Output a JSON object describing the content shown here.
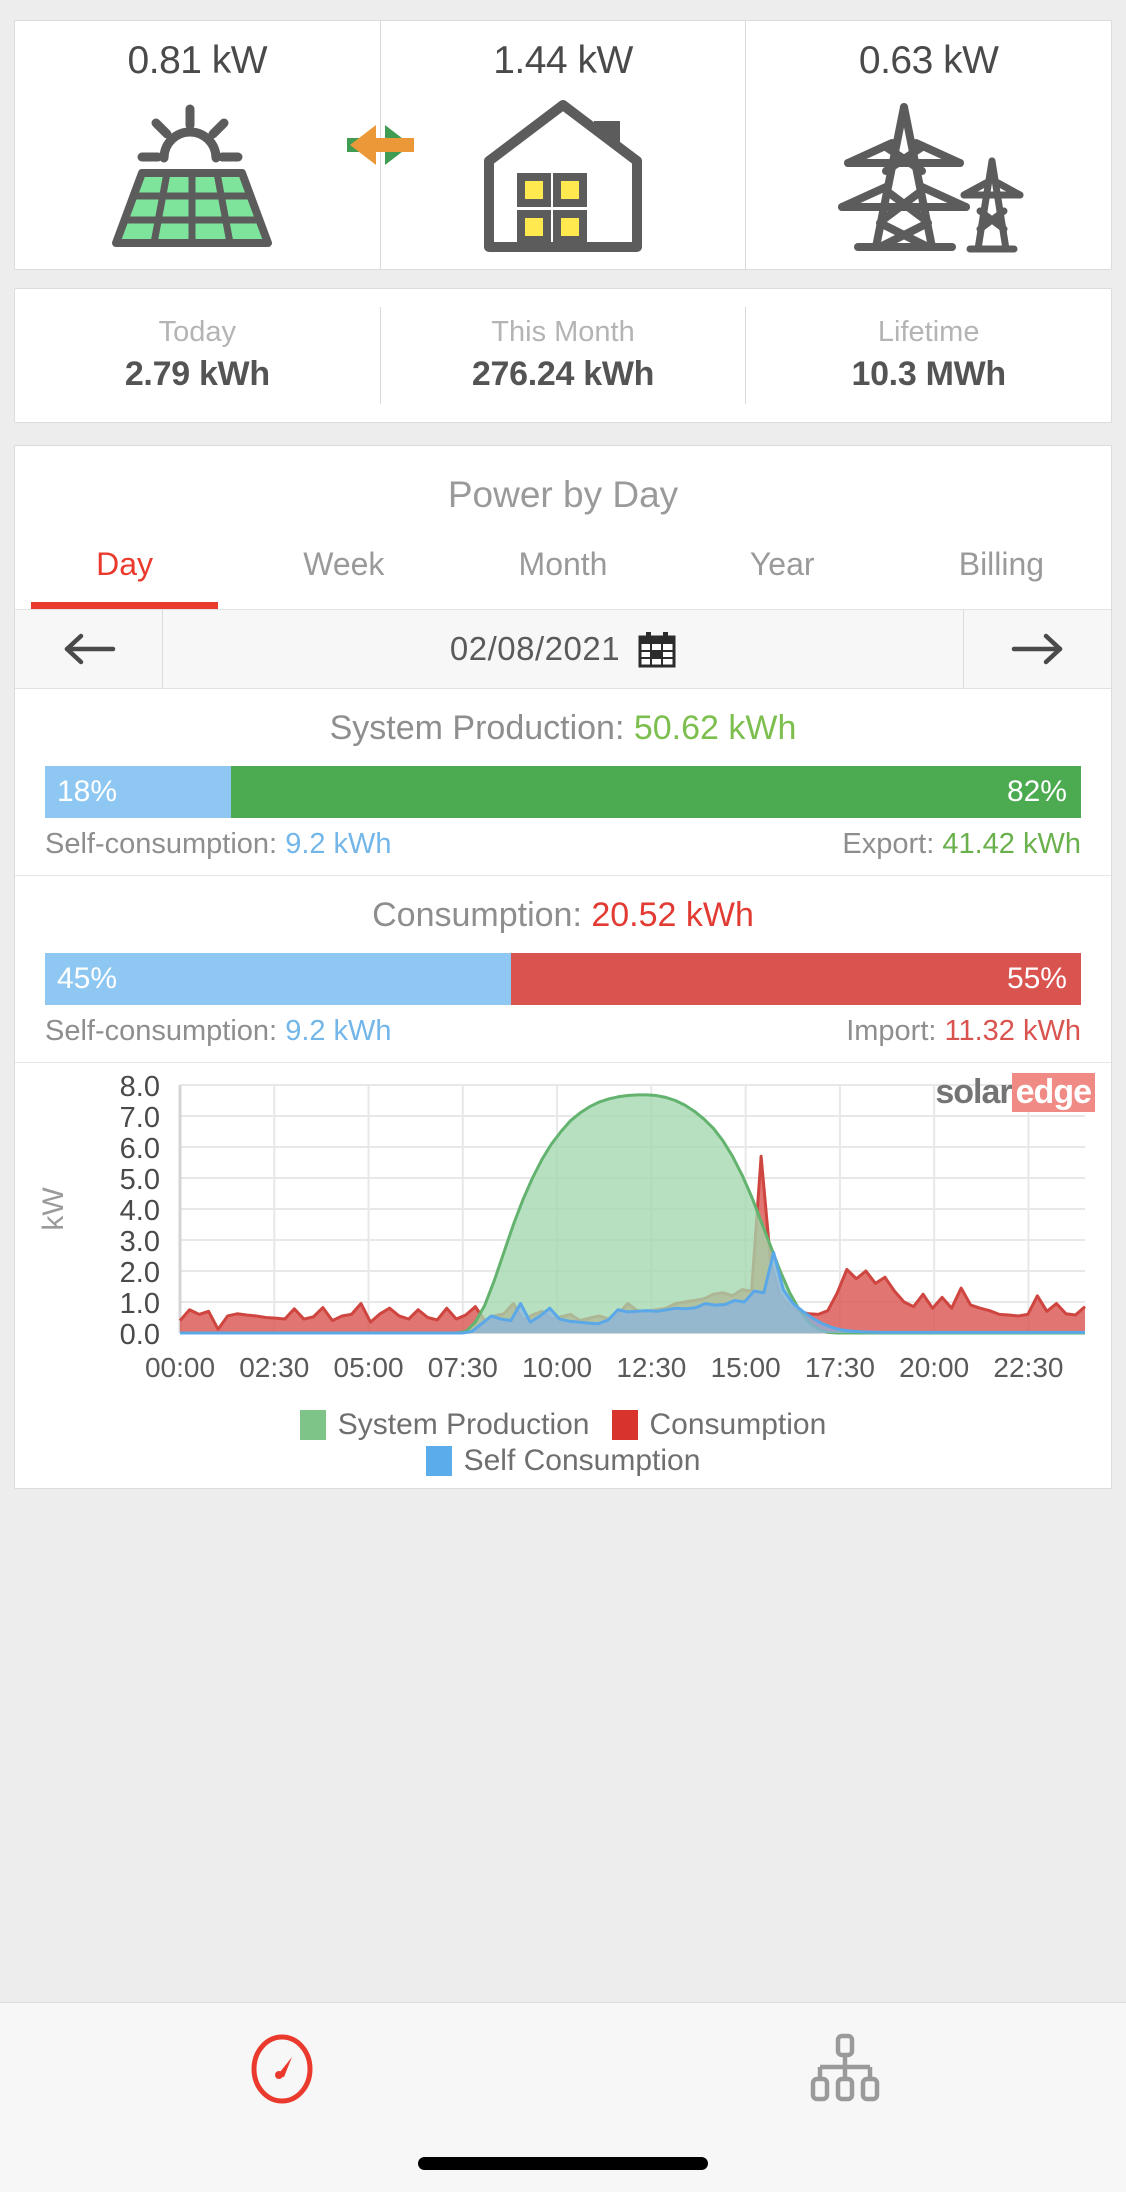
{
  "flow": {
    "cells": [
      {
        "value": "0.81 kW",
        "icon": "solar-panel-icon",
        "name": "production"
      },
      {
        "value": "1.44 kW",
        "icon": "house-icon",
        "name": "consumption"
      },
      {
        "value": "0.63 kW",
        "icon": "grid-tower-icon",
        "name": "grid"
      }
    ],
    "arrow_production_to_house": {
      "icon": "arrow-right-icon",
      "color": "#3f9c52"
    },
    "arrow_grid_to_house": {
      "icon": "arrow-left-icon",
      "color": "#eb9838"
    }
  },
  "stats": [
    {
      "label": "Today",
      "value": "2.79 kWh"
    },
    {
      "label": "This Month",
      "value": "276.24 kWh"
    },
    {
      "label": "Lifetime",
      "value": "10.3 MWh"
    }
  ],
  "power": {
    "title": "Power by Day",
    "tabs": [
      {
        "label": "Day",
        "active": true
      },
      {
        "label": "Week",
        "active": false
      },
      {
        "label": "Month",
        "active": false
      },
      {
        "label": "Year",
        "active": false
      },
      {
        "label": "Billing",
        "active": false
      }
    ],
    "date": {
      "prev_icon": "arrow-left-icon",
      "next_icon": "arrow-right-icon",
      "value": "02/08/2021",
      "calendar_icon": "calendar-icon"
    },
    "production": {
      "head_label": "System Production:",
      "head_value": "50.62 kWh",
      "left_pct": "18%",
      "right_pct": "82%",
      "left_pct_num": 18,
      "right_pct_num": 82,
      "foot_left_label": "Self-consumption:",
      "foot_left_value": "9.2 kWh",
      "foot_right_label": "Export:",
      "foot_right_value": "41.42 kWh"
    },
    "consumption": {
      "head_label": "Consumption:",
      "head_value": "20.52 kWh",
      "left_pct": "45%",
      "right_pct": "55%",
      "left_pct_num": 45,
      "right_pct_num": 55,
      "foot_left_label": "Self-consumption:",
      "foot_left_value": "9.2 kWh",
      "foot_right_label": "Import:",
      "foot_right_value": "11.32 kWh"
    },
    "brand": {
      "part1": "solar",
      "part2": "edge"
    }
  },
  "chart_data": {
    "type": "area",
    "title": "Power by Day",
    "xlabel": "",
    "ylabel": "kW",
    "ylim": [
      0,
      8
    ],
    "yticks": [
      "0.0",
      "1.0",
      "2.0",
      "3.0",
      "4.0",
      "5.0",
      "6.0",
      "7.0",
      "8.0"
    ],
    "xticks": [
      "00:00",
      "02:30",
      "05:00",
      "07:30",
      "10:00",
      "12:30",
      "15:00",
      "17:30",
      "20:00",
      "22:30"
    ],
    "grid": true,
    "legend_position": "bottom",
    "x_hours_range": [
      0,
      24
    ],
    "series": [
      {
        "name": "System Production",
        "color": "#a3d7ae",
        "line_color": "#63b36f",
        "values": [
          0,
          0,
          0,
          0,
          0,
          0,
          0,
          0,
          0,
          0,
          0,
          0,
          0,
          0,
          0,
          0,
          0,
          0,
          0,
          0,
          0,
          0,
          0,
          0,
          0,
          0,
          0,
          0,
          0,
          0,
          0.05,
          0.35,
          0.9,
          1.7,
          2.6,
          3.5,
          4.3,
          5.0,
          5.6,
          6.1,
          6.5,
          6.85,
          7.1,
          7.3,
          7.45,
          7.55,
          7.62,
          7.66,
          7.68,
          7.68,
          7.66,
          7.6,
          7.5,
          7.35,
          7.15,
          6.9,
          6.6,
          6.2,
          5.7,
          5.1,
          4.4,
          3.6,
          2.8,
          2.0,
          1.3,
          0.75,
          0.35,
          0.12,
          0.02,
          0,
          0,
          0,
          0,
          0,
          0,
          0,
          0,
          0,
          0,
          0,
          0,
          0,
          0,
          0,
          0,
          0,
          0,
          0,
          0,
          0,
          0,
          0,
          0,
          0,
          0,
          0
        ]
      },
      {
        "name": "Consumption",
        "color": "#d9534f",
        "line_color": "#cf4540",
        "values": [
          0.4,
          0.75,
          0.6,
          0.7,
          0.12,
          0.55,
          0.62,
          0.58,
          0.55,
          0.5,
          0.48,
          0.45,
          0.78,
          0.45,
          0.52,
          0.82,
          0.4,
          0.55,
          0.6,
          0.95,
          0.35,
          0.62,
          0.8,
          0.55,
          0.45,
          0.75,
          0.5,
          0.42,
          0.8,
          0.45,
          0.58,
          0.85,
          0.4,
          0.55,
          0.62,
          0.95,
          0.42,
          0.58,
          0.7,
          0.45,
          0.52,
          0.6,
          0.4,
          0.48,
          0.55,
          0.45,
          0.6,
          0.95,
          0.72,
          0.7,
          0.75,
          0.8,
          0.95,
          1.0,
          1.05,
          1.1,
          1.25,
          1.3,
          1.2,
          1.4,
          1.35,
          5.7,
          2.3,
          1.2,
          0.85,
          0.7,
          0.62,
          0.6,
          0.72,
          1.3,
          2.05,
          1.75,
          2.0,
          1.6,
          1.8,
          1.35,
          1.0,
          0.85,
          1.25,
          0.8,
          1.15,
          0.8,
          1.45,
          0.9,
          0.8,
          0.72,
          0.6,
          0.58,
          0.55,
          0.6,
          1.2,
          0.7,
          0.95,
          0.62,
          0.58,
          0.85
        ]
      },
      {
        "name": "Self Consumption",
        "color": "#8ab4e0",
        "line_color": "#5aa8e8",
        "values": [
          0,
          0,
          0,
          0,
          0,
          0,
          0,
          0,
          0,
          0,
          0,
          0,
          0,
          0,
          0,
          0,
          0,
          0,
          0,
          0,
          0,
          0,
          0,
          0,
          0,
          0,
          0,
          0,
          0,
          0,
          0.05,
          0.3,
          0.55,
          0.45,
          0.4,
          0.95,
          0.35,
          0.55,
          0.8,
          0.45,
          0.38,
          0.35,
          0.32,
          0.3,
          0.42,
          0.75,
          0.68,
          0.7,
          0.72,
          0.7,
          0.75,
          0.8,
          0.78,
          0.82,
          0.95,
          0.9,
          0.92,
          1.05,
          1.0,
          1.35,
          1.3,
          2.6,
          1.4,
          0.95,
          0.7,
          0.48,
          0.3,
          0.18,
          0.1,
          0.06,
          0.04,
          0.03,
          0.02,
          0.02,
          0.02,
          0.02,
          0.02,
          0.02,
          0.02,
          0.02,
          0.02,
          0.02,
          0.02,
          0.02,
          0.02,
          0.02,
          0.02,
          0.02,
          0.02,
          0.02,
          0.02,
          0.02,
          0.02,
          0.02
        ]
      }
    ],
    "legend": [
      {
        "label": "System Production",
        "color": "#7ec488"
      },
      {
        "label": "Consumption",
        "color": "#d9342c"
      },
      {
        "label": "Self Consumption",
        "color": "#5aaceb"
      }
    ]
  },
  "bottom_nav": [
    {
      "name": "dashboard",
      "icon": "gauge-icon",
      "active": true,
      "color": "#ea3a2d"
    },
    {
      "name": "layout",
      "icon": "site-layout-icon",
      "active": false,
      "color": "#9a9a9a"
    }
  ]
}
